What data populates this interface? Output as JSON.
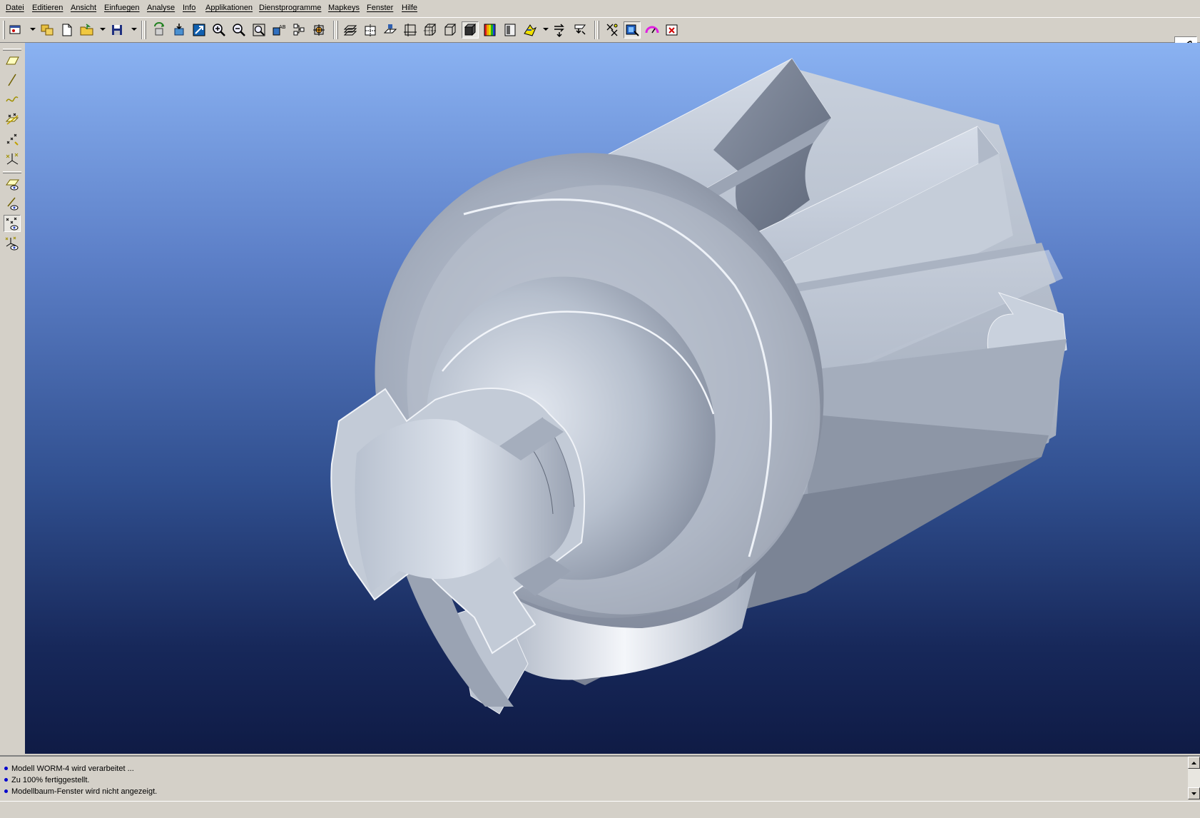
{
  "menu": {
    "items": [
      "Datei",
      "Editieren",
      "Ansicht",
      "Einfuegen",
      "Analyse",
      "Info",
      "Applikationen",
      "Dienstprogramme",
      "Mapkeys",
      "Fenster",
      "Hilfe"
    ]
  },
  "toolbar": {
    "icons": [
      "window-icon",
      "copy-icon",
      "new-file-icon",
      "open-folder-icon",
      "save-icon",
      "regenerate-icon",
      "view-orient-icon",
      "refit-icon",
      "zoom-in-icon",
      "zoom-out-icon",
      "zoom-area-icon",
      "named-view-icon",
      "layers-icon",
      "spin-center-icon",
      "datum-planes-icon",
      "datum-axes-icon",
      "datum-points-icon",
      "coordinate-system-icon",
      "wireframe-icon",
      "hidden-line-icon",
      "no-hidden-icon",
      "shading-icon",
      "color-appearance-icon",
      "model-tree-icon",
      "mapkey-icon",
      "repaint-icon",
      "whats-this-icon",
      "selection-filter-icon",
      "analysis-icon",
      "close-icon",
      "signature-icon"
    ]
  },
  "left_toolbar": {
    "icons": [
      "datum-plane-tool-icon",
      "datum-axis-tool-icon",
      "datum-curve-tool-icon",
      "datum-point-tool-icon",
      "sketched-point-icon",
      "coordinate-system-tool-icon",
      "plane-display-icon",
      "axis-display-icon",
      "point-display-icon",
      "csys-display-icon"
    ]
  },
  "viewport": {
    "model_name": "WORM-4",
    "background_top": "#8ab2f2",
    "background_bottom": "#0f1b45"
  },
  "messages": [
    "Modell WORM-4 wird verarbeitet ...",
    "Zu 100% fertiggestellt.",
    "Modellbaum-Fenster wird nicht angezeigt."
  ]
}
